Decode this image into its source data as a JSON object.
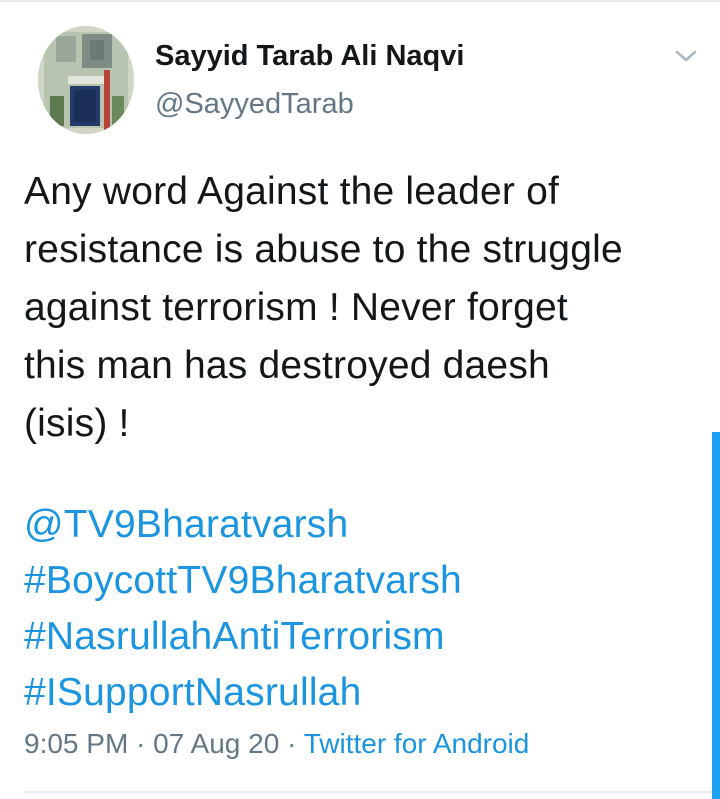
{
  "author": {
    "display_name": "Sayyid Tarab Ali Naqvi",
    "handle": "@SayyedTarab",
    "avatar_icon": "avatar-photo"
  },
  "tweet": {
    "text_lines": [
      "Any word Against the leader of",
      "resistance is abuse to the struggle",
      "against terrorism ! Never forget",
      "this man has destroyed daesh",
      "(isis) !"
    ],
    "mention": "@TV9Bharatvarsh",
    "hashtags": [
      "#BoycottTV9Bharatvarsh",
      "#NasrullahAntiTerrorism",
      "#ISupportNasrullah"
    ]
  },
  "meta": {
    "time": "9:05 PM",
    "separator": "·",
    "date": "07 Aug 20",
    "source": "Twitter for Android"
  },
  "colors": {
    "link": "#1b95e0",
    "text": "#14171a",
    "muted": "#657786",
    "accent": "#1da1f2"
  },
  "icons": {
    "menu": "chevron-down-icon"
  }
}
